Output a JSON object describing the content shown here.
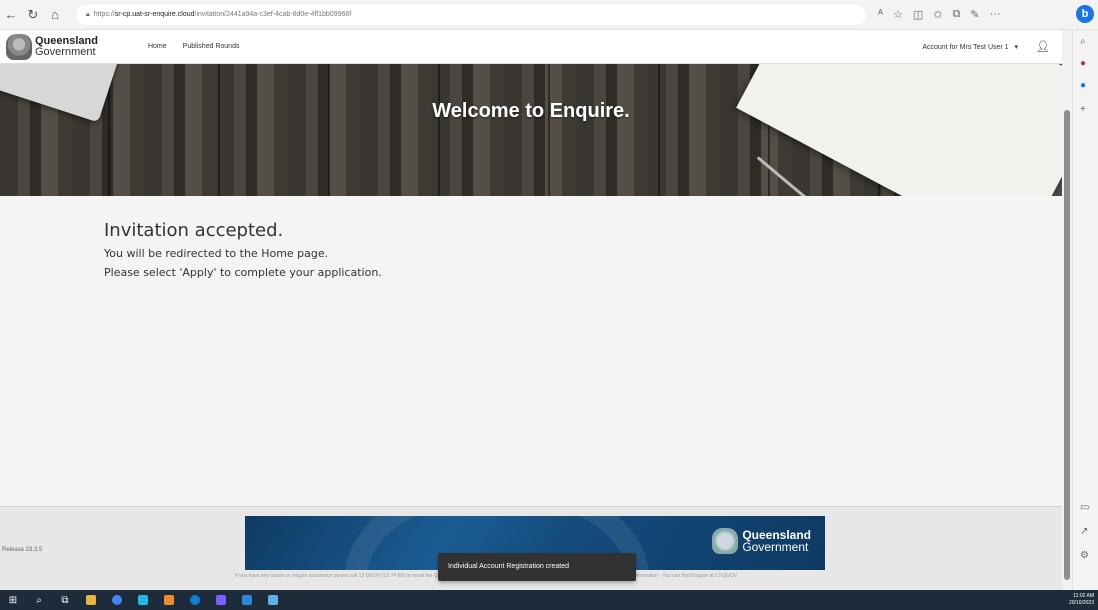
{
  "browser": {
    "url_prefix": "https://",
    "url_host": "sr-cp.uat-sr-enquire.cloud",
    "url_path": "/invitation/2441a94a-c3ef-4cab-8d0e-4ff1bb09966f",
    "icons": [
      "back-icon",
      "refresh-icon",
      "home-icon",
      "lock-icon",
      "read-aloud-icon",
      "favorite-icon",
      "split-screen-icon",
      "favorites-icon",
      "collections-icon",
      "extensions-icon",
      "more-icon"
    ],
    "profile_badge": "b"
  },
  "header": {
    "logo_line1": "Queensland",
    "logo_line2": "Government",
    "nav": [
      {
        "label": "Home"
      },
      {
        "label": "Published Rounds"
      }
    ],
    "account_label": "Account for Mrs Test User 1",
    "account_caret": "▾"
  },
  "hero": {
    "title": "Welcome to Enquire."
  },
  "main": {
    "heading": "Invitation accepted.",
    "line1": "You will be redirected to the Home page.",
    "line2": "Please select 'Apply' to complete your application."
  },
  "footer": {
    "version": "Release 23.3.5",
    "banner_line1": "Queensland",
    "banner_line2": "Government",
    "fine_print": "If you have any issues or require assistance please call 13 QGOV (13 74 68) or email the Queensland Government Enquire team at support. The Queensland Government Enquire Information - You can find Enquire at 13 QGOV"
  },
  "toast": {
    "message": "Individual Account Registration created"
  },
  "taskbar": {
    "clock_time": "11:02 AM",
    "clock_date": "20/10/2023",
    "colors": [
      "#3b82f6",
      "#e8b33c",
      "#4285f4",
      "#1fb8e8",
      "#f28b30",
      "#0f7fd4",
      "#7b61ff",
      "#2b88d8",
      "#5fb0e8"
    ]
  }
}
